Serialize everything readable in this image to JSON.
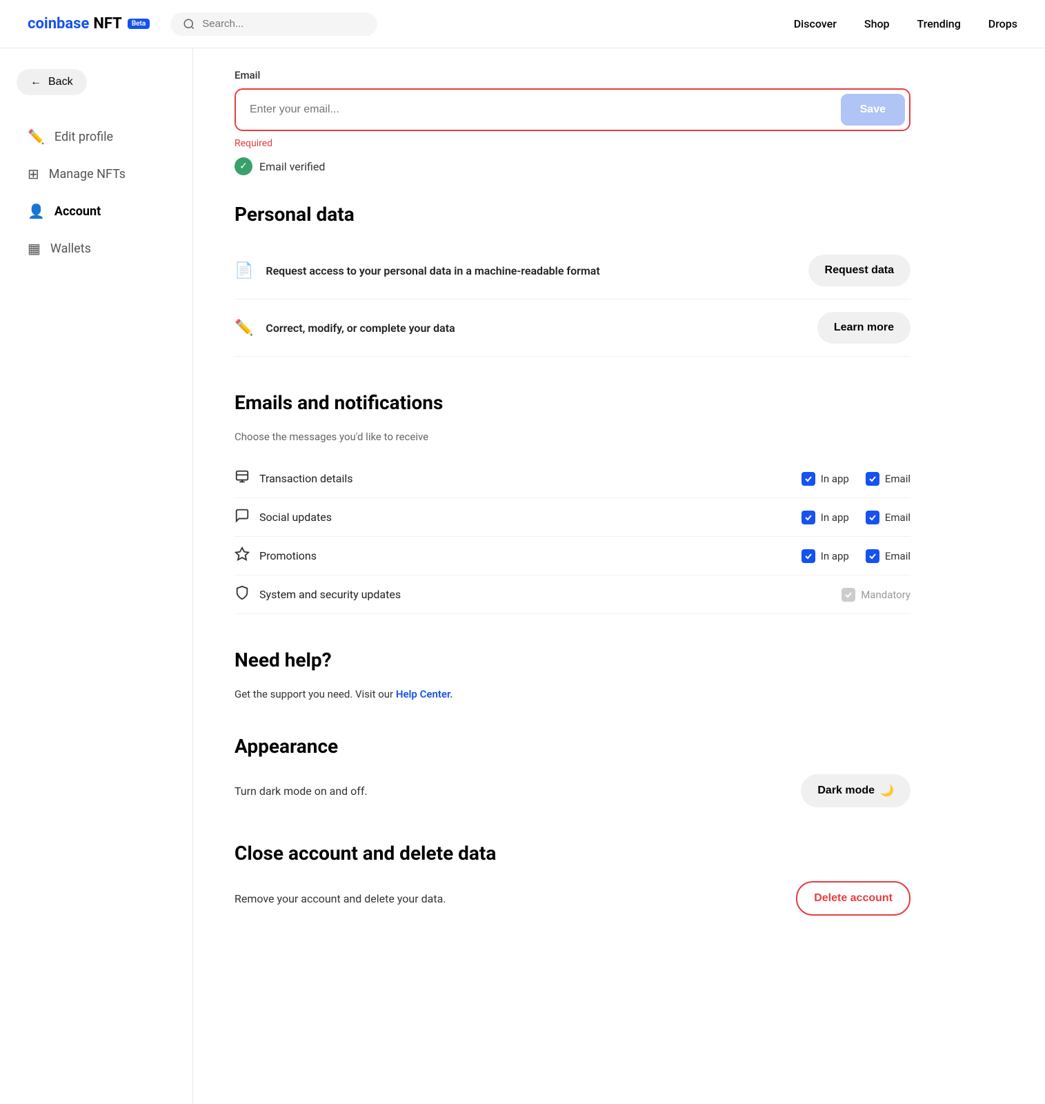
{
  "navbar": {
    "logo_coinbase": "coinbase",
    "logo_nft": "NFT",
    "beta_label": "Beta",
    "search_placeholder": "Search...",
    "links": [
      {
        "label": "Discover",
        "name": "discover"
      },
      {
        "label": "Shop",
        "name": "shop"
      },
      {
        "label": "Trending",
        "name": "trending"
      },
      {
        "label": "Drops",
        "name": "drops"
      }
    ]
  },
  "sidebar": {
    "back_label": "Back",
    "items": [
      {
        "label": "Edit profile",
        "icon": "✏️",
        "name": "edit-profile",
        "active": false
      },
      {
        "label": "Manage NFTs",
        "icon": "⊞",
        "name": "manage-nfts",
        "active": false
      },
      {
        "label": "Account",
        "icon": "👤",
        "name": "account",
        "active": true
      },
      {
        "label": "Wallets",
        "icon": "▦",
        "name": "wallets",
        "active": false
      }
    ]
  },
  "email_section": {
    "label": "Email",
    "placeholder": "Enter your email...",
    "save_btn": "Save",
    "required_text": "Required",
    "verified_text": "Email verified"
  },
  "personal_data": {
    "title": "Personal data",
    "rows": [
      {
        "icon": "📄",
        "text": "Request access to your personal data in a machine-readable format",
        "action": "Request data"
      },
      {
        "icon": "✏️",
        "text": "Correct, modify, or complete your data",
        "action": "Learn more"
      }
    ]
  },
  "notifications": {
    "title": "Emails and notifications",
    "subtitle": "Choose the messages you'd like to receive",
    "rows": [
      {
        "icon": "💬",
        "label": "Transaction details",
        "in_app": true,
        "email": true,
        "mandatory": false
      },
      {
        "icon": "💬",
        "label": "Social updates",
        "in_app": true,
        "email": true,
        "mandatory": false
      },
      {
        "icon": "◇",
        "label": "Promotions",
        "in_app": true,
        "email": true,
        "mandatory": false
      },
      {
        "icon": "🛡",
        "label": "System and security updates",
        "in_app": null,
        "email": null,
        "mandatory": true
      }
    ],
    "in_app_label": "In app",
    "email_label": "Email",
    "mandatory_label": "Mandatory"
  },
  "help": {
    "title": "Need help?",
    "text_before": "Get the support you need. Visit our ",
    "link_text": "Help Center.",
    "link_url": "#"
  },
  "appearance": {
    "title": "Appearance",
    "desc": "Turn dark mode on and off.",
    "dark_mode_btn": "Dark mode"
  },
  "delete_account": {
    "title": "Close account and delete data",
    "desc": "Remove your account and delete your data.",
    "btn_label": "Delete account"
  }
}
